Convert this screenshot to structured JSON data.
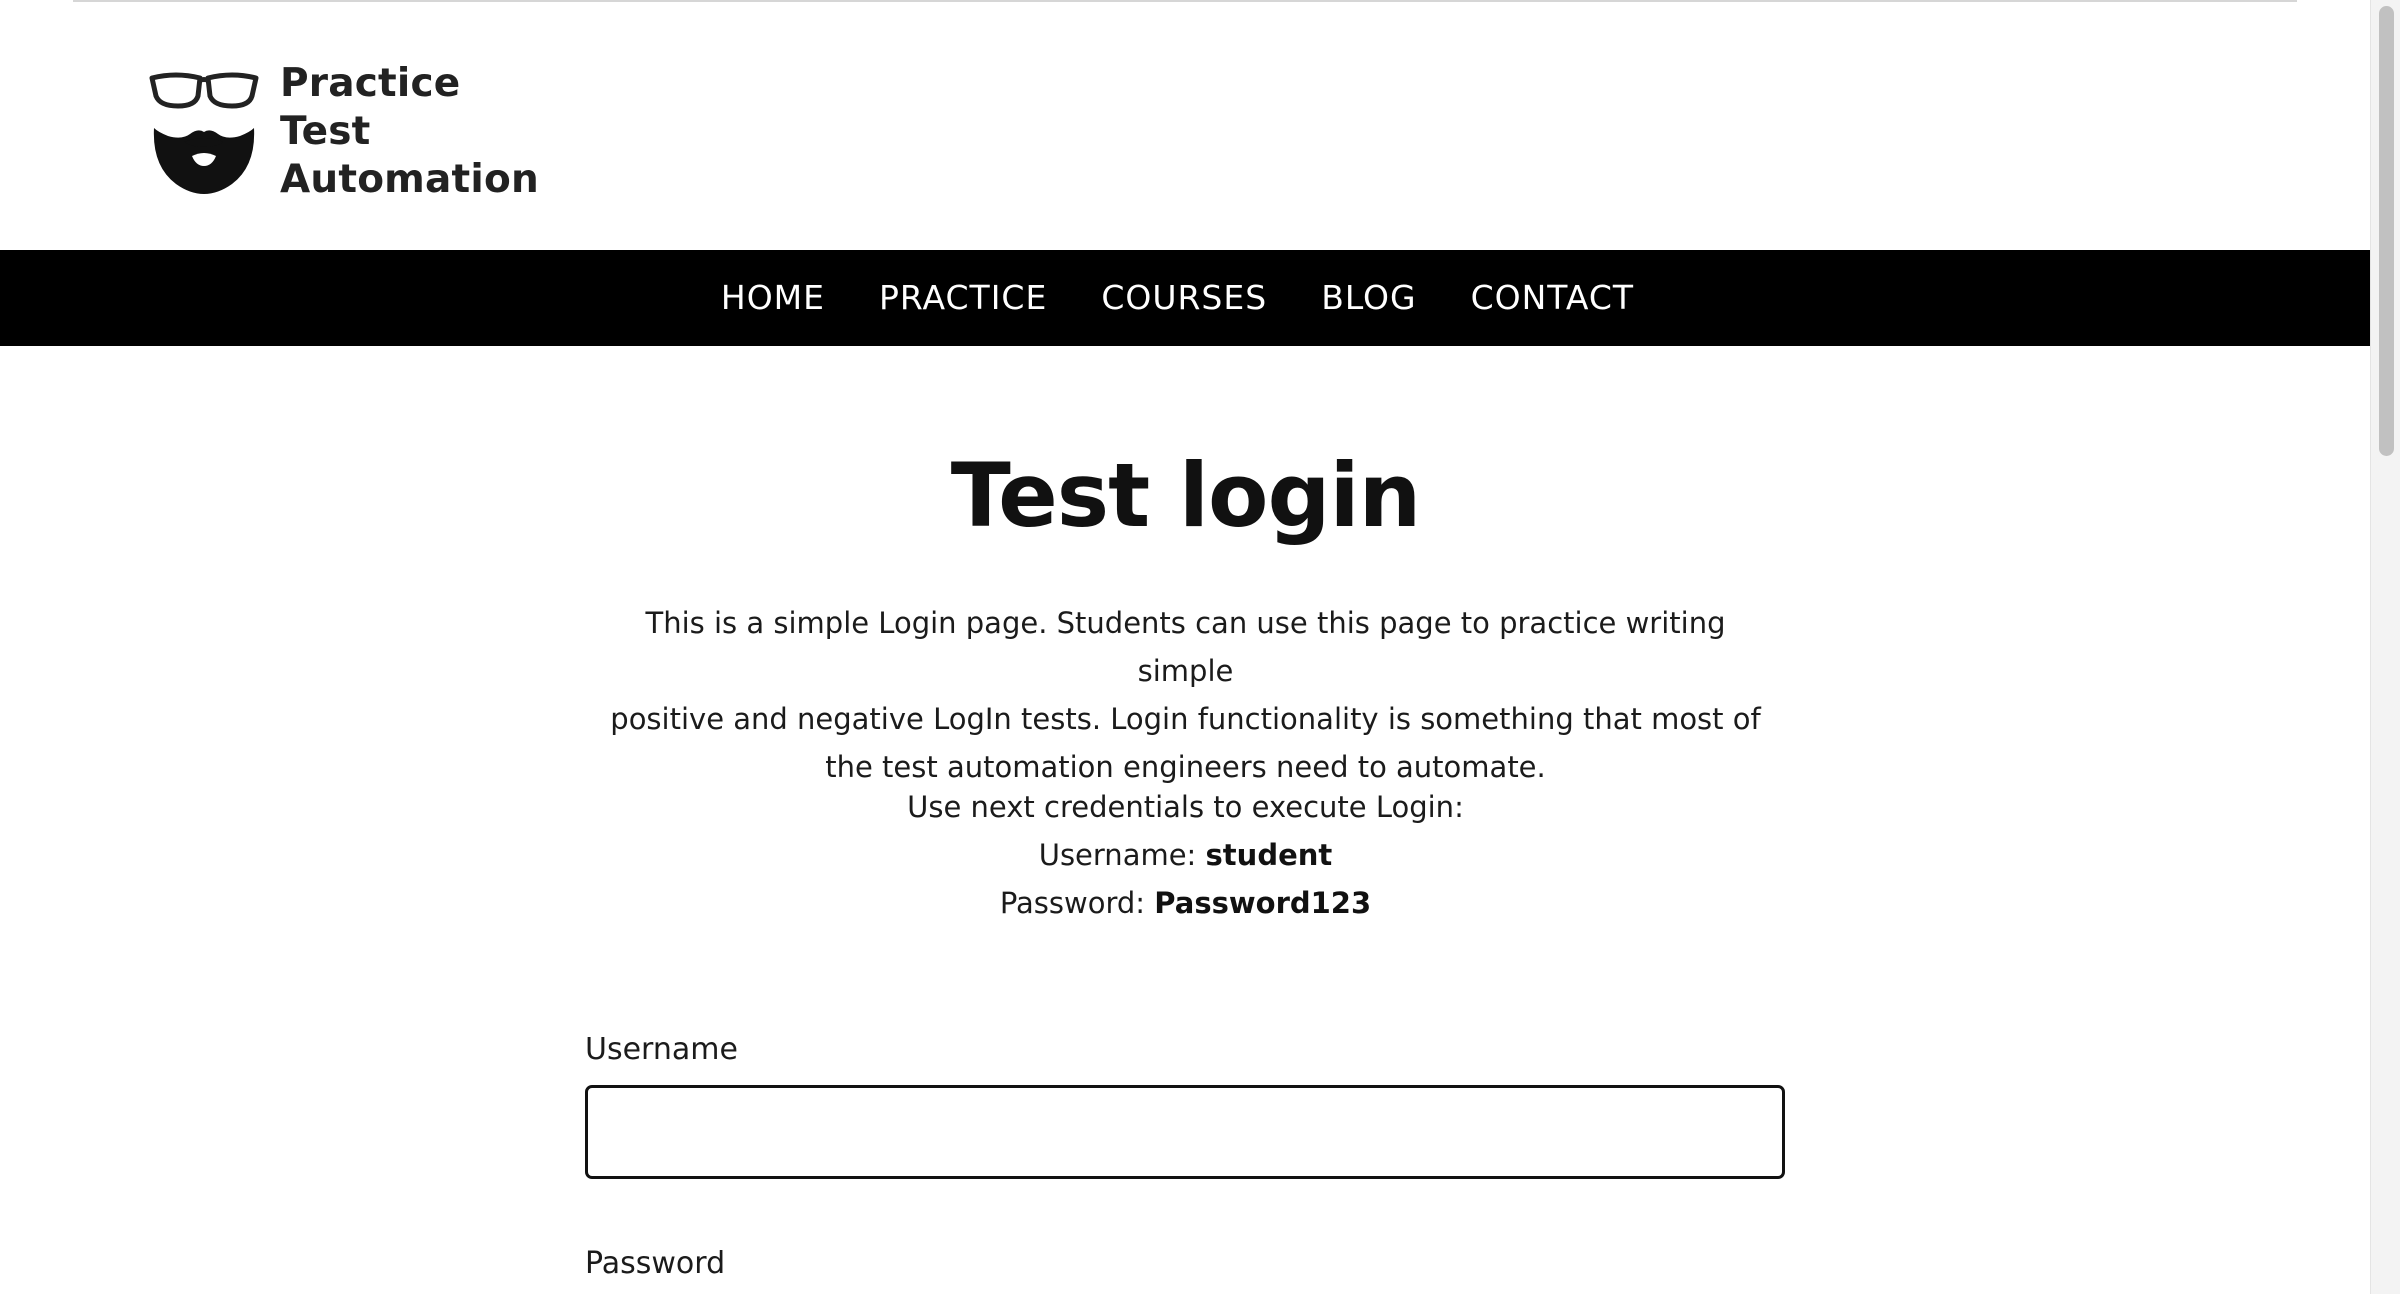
{
  "header": {
    "logo_line1": "Practice",
    "logo_line2": "Test Automation",
    "logo_icon": "glasses-beard-icon"
  },
  "nav": {
    "items": [
      {
        "label": "HOME"
      },
      {
        "label": "PRACTICE"
      },
      {
        "label": "COURSES"
      },
      {
        "label": "BLOG"
      },
      {
        "label": "CONTACT"
      }
    ]
  },
  "main": {
    "title": "Test login",
    "intro_line1": "This is a simple Login page. Students can use this page to practice writing simple",
    "intro_line2": "positive and negative LogIn tests. Login functionality is something that most of",
    "intro_line3": "the test automation engineers need to automate.",
    "credentials_heading": "Use next credentials to execute Login:",
    "username_prefix": "Username: ",
    "username_value": "student",
    "password_prefix": "Password: ",
    "password_value": "Password123"
  },
  "form": {
    "username_label": "Username",
    "username_value": "",
    "password_label": "Password"
  },
  "colors": {
    "nav_background": "#000000",
    "nav_text": "#ffffff",
    "page_background": "#ffffff",
    "input_border": "#111111"
  }
}
